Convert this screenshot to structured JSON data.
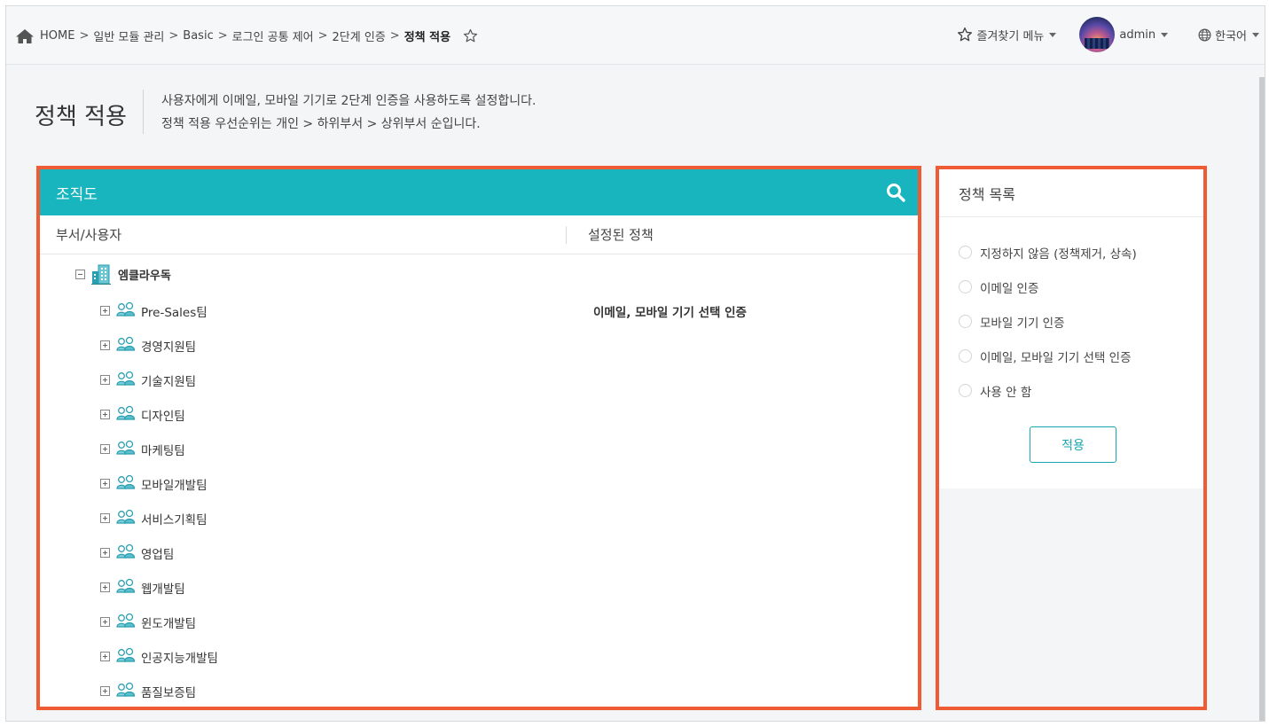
{
  "breadcrumb": {
    "home_icon": "home-icon",
    "items": [
      "HOME",
      "일반 모듈 관리",
      "Basic",
      "로그인 공통 제어",
      "2단계 인증"
    ],
    "separator": ">",
    "current": "정책 적용",
    "star_icon": "star-outline-icon"
  },
  "topnav": {
    "favorites_label": "즐겨찾기 메뉴",
    "user_name": "admin",
    "language": "한국어"
  },
  "page": {
    "title": "정책 적용",
    "desc_line1": "사용자에게 이메일, 모바일 기기로 2단계 인증을 사용하도록 설정합니다.",
    "desc_line2": "정책 적용 우선순위는 개인 > 하위부서 > 상위부서 순입니다."
  },
  "org": {
    "title": "조직도",
    "col_dept": "부서/사용자",
    "col_policy": "설정된 정책",
    "root": "엠클라우독",
    "teams": [
      {
        "name": "Pre-Sales팀",
        "policy": "이메일, 모바일 기기 선택 인증"
      },
      {
        "name": "경영지원팀",
        "policy": ""
      },
      {
        "name": "기술지원팀",
        "policy": ""
      },
      {
        "name": "디자인팀",
        "policy": ""
      },
      {
        "name": "마케팅팀",
        "policy": ""
      },
      {
        "name": "모바일개발팀",
        "policy": ""
      },
      {
        "name": "서비스기획팀",
        "policy": ""
      },
      {
        "name": "영업팀",
        "policy": ""
      },
      {
        "name": "웹개발팀",
        "policy": ""
      },
      {
        "name": "윈도개발팀",
        "policy": ""
      },
      {
        "name": "인공지능개발팀",
        "policy": ""
      },
      {
        "name": "품질보증팀",
        "policy": ""
      }
    ]
  },
  "policy_list": {
    "title": "정책 목록",
    "options": [
      "지정하지 않음 (정책제거, 상속)",
      "이메일 인증",
      "모바일 기기 인증",
      "이메일, 모바일 기기 선택 인증",
      "사용 안 함"
    ],
    "apply_label": "적용"
  },
  "colors": {
    "accent": "#18b5be",
    "highlight_border": "#ee5b35"
  }
}
